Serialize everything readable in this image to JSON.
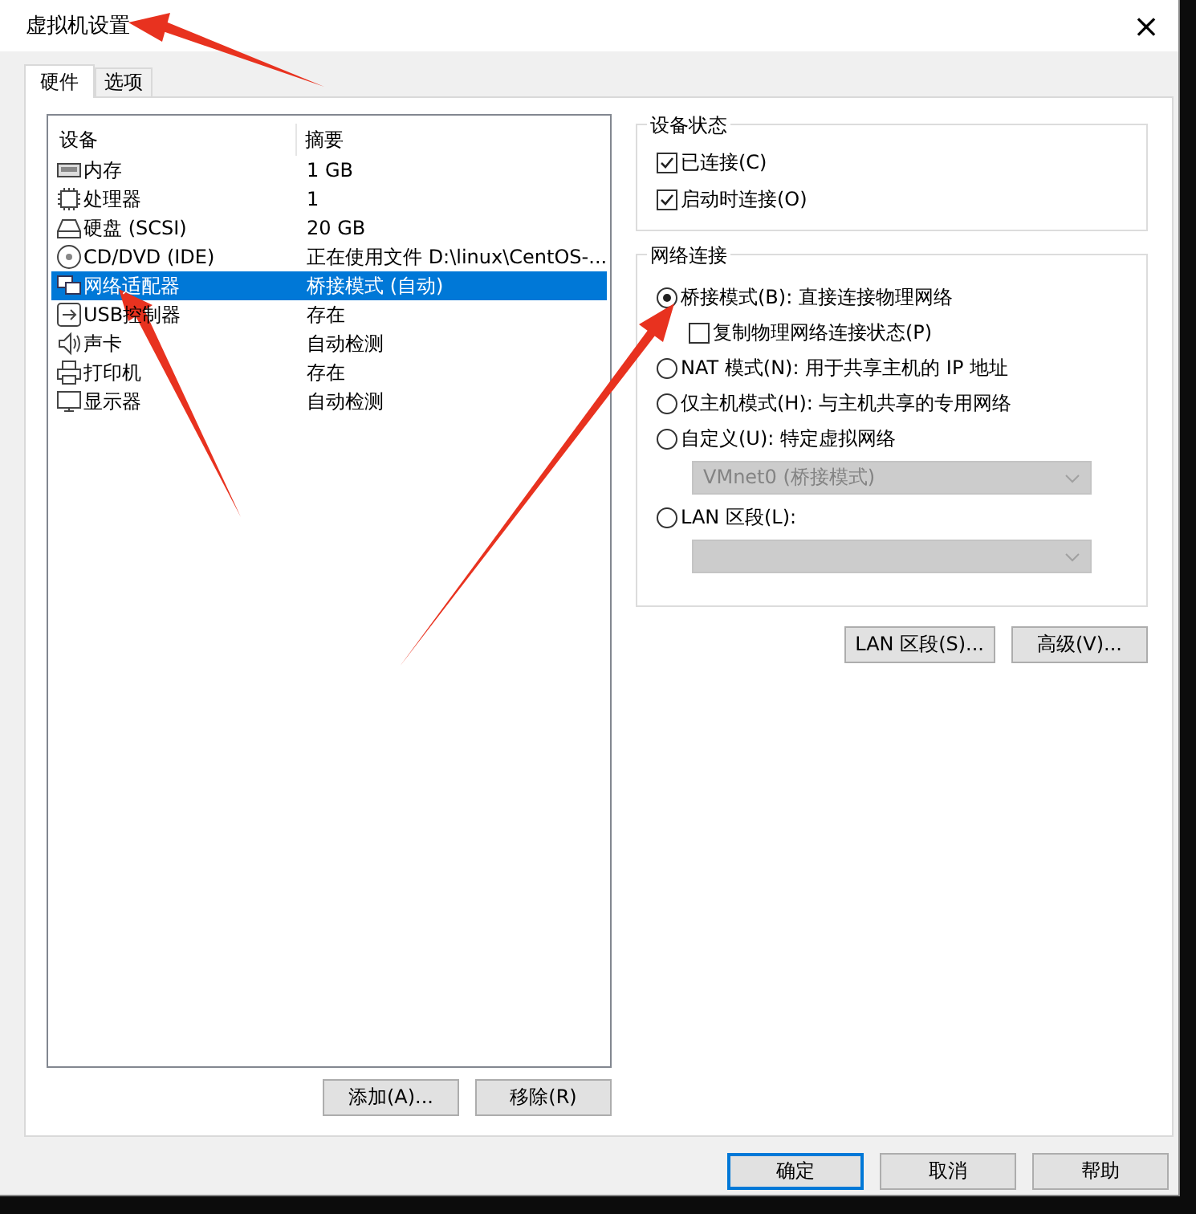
{
  "window": {
    "title": "虚拟机设置",
    "close": "×"
  },
  "tabs": [
    {
      "label": "硬件",
      "selected": true
    },
    {
      "label": "选项",
      "selected": false
    }
  ],
  "devices": {
    "columns": [
      "设备",
      "摘要"
    ],
    "rows": [
      {
        "kind": "memory",
        "name": "内存",
        "summary": "1 GB",
        "selected": false
      },
      {
        "kind": "cpu",
        "name": "处理器",
        "summary": "1",
        "selected": false
      },
      {
        "kind": "disk",
        "name": "硬盘 (SCSI)",
        "summary": "20 GB",
        "selected": false
      },
      {
        "kind": "cdrom",
        "name": "CD/DVD (IDE)",
        "summary": "正在使用文件 D:\\linux\\CentOS-...",
        "selected": false
      },
      {
        "kind": "network",
        "name": "网络适配器",
        "summary": "桥接模式 (自动)",
        "selected": true
      },
      {
        "kind": "usb",
        "name": "USB控制器",
        "summary": "存在",
        "selected": false
      },
      {
        "kind": "sound",
        "name": "声卡",
        "summary": "自动检测",
        "selected": false
      },
      {
        "kind": "printer",
        "name": "打印机",
        "summary": "存在",
        "selected": false
      },
      {
        "kind": "display",
        "name": "显示器",
        "summary": "自动检测",
        "selected": false
      }
    ],
    "buttons": [
      "添加(A)...",
      "移除(R)"
    ]
  },
  "device_status": {
    "title": "设备状态",
    "options": [
      {
        "label": "已连接(C)",
        "checked": true
      },
      {
        "label": "启动时连接(O)",
        "checked": true
      }
    ]
  },
  "network_connection": {
    "title": "网络连接",
    "items": [
      {
        "kind": "radio",
        "label": "桥接模式(B): 直接连接物理网络",
        "selected": true
      },
      {
        "kind": "checkbox",
        "label": "复制物理网络连接状态(P)",
        "checked": false
      },
      {
        "kind": "radio",
        "label": "NAT 模式(N): 用于共享主机的 IP 地址",
        "selected": false
      },
      {
        "kind": "radio",
        "label": "仅主机模式(H): 与主机共享的专用网络",
        "selected": false
      },
      {
        "kind": "radio",
        "label": "自定义(U): 特定虚拟网络",
        "selected": false
      },
      {
        "kind": "dropdown",
        "value": "VMnet0 (桥接模式)",
        "disabled": true
      },
      {
        "kind": "radio",
        "label": "LAN 区段(L):",
        "selected": false
      },
      {
        "kind": "dropdown",
        "disabled": true
      }
    ],
    "buttons": [
      "LAN 区段(S)...",
      "高级(V)..."
    ]
  },
  "footer_buttons": [
    {
      "label": "确定",
      "focused": true
    },
    {
      "label": "取消",
      "focused": false
    },
    {
      "label": "帮助",
      "focused": false
    }
  ]
}
